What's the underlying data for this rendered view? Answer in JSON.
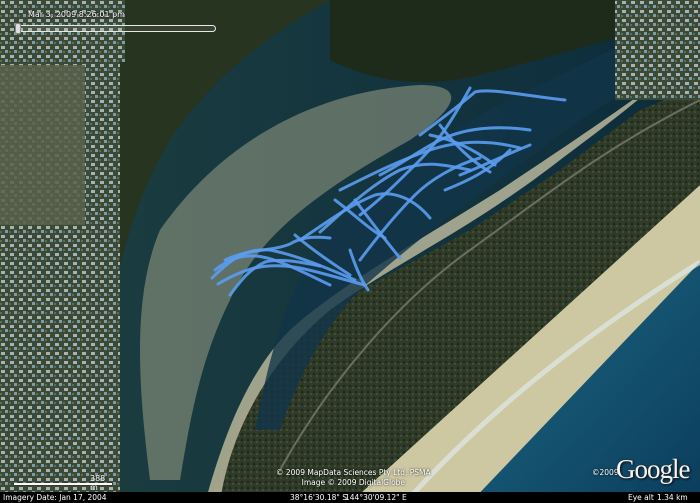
{
  "time_slider": {
    "label": "Mar 3, 2009  8:26:01 pm"
  },
  "scale": {
    "label": "388 m"
  },
  "copyright": {
    "line1": "© 2009 MapData Sciences Pty Ltd, PSMA",
    "line2": "Image © 2009 DigitalGlobe"
  },
  "logo": {
    "year": "©2009",
    "word": "Google"
  },
  "status_bar": {
    "imagery_date": "Imagery Date: Jan 17, 2004",
    "latitude": "38°16'30.18\" S",
    "longitude": "144°30'09.12\" E",
    "eye_alt_label": "Eye alt",
    "eye_alt_value": "1.34 km"
  },
  "colors": {
    "track": "#5b9cf0",
    "water_deep": "#0e3f59",
    "sand": "#c9c7a3",
    "vegetation": "#2d3a24"
  },
  "icons": {
    "slider_handle": "slider-handle-icon"
  }
}
